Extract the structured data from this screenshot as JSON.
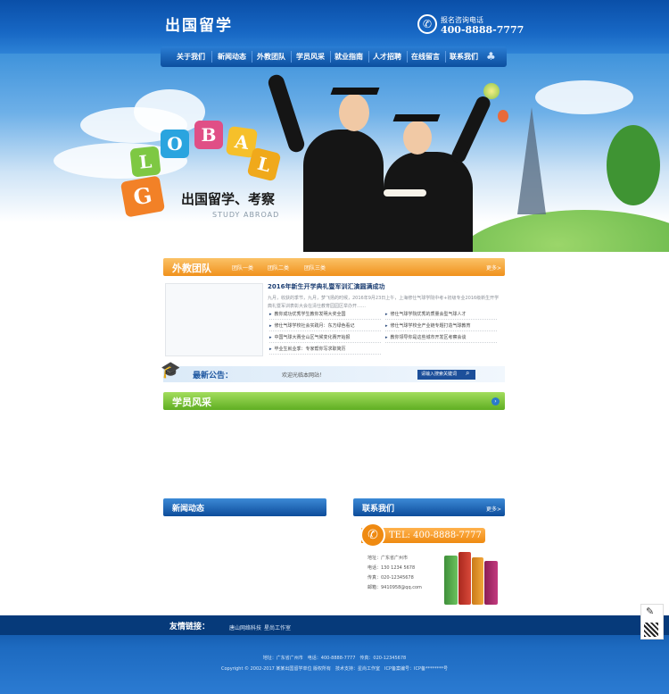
{
  "header": {
    "logo": "出国留学",
    "hotline_label": "报名咨询电话",
    "hotline_number": "400-8888-7777"
  },
  "nav": {
    "items": [
      "关于我们",
      "新闻动态",
      "外教团队",
      "学员风采",
      "就业指南",
      "人才招聘",
      "在线留言",
      "联系我们"
    ]
  },
  "banner": {
    "letters": [
      "G",
      "L",
      "O",
      "B",
      "A",
      "L"
    ],
    "title": "出国留学、考察",
    "subtitle": "STUDY ABROAD"
  },
  "teacher": {
    "title": "外教团队",
    "tabs": [
      "团队一类",
      "团队二类",
      "团队三类"
    ],
    "more": "更多>",
    "news_head": "2016年新生开学典礼暨军训汇演圆满成功",
    "news_summary": "九月，收获的季节，九月，梦飞扬的时候，2016年9月23日上午，上海修仕气球学院中考+初级专业2016级新生开学典礼暨军训表彰大会在清仕教育园园区举办开……",
    "news_left": [
      "教你成功优秀学生教你发明大奖全国",
      "修仕气球学校社会实践月：东方绿色看记",
      "中国气球大赛全山区气候变化赛开始报",
      "毕业生就业季：专家帮你写求职简历"
    ],
    "news_right": [
      "修仕气球学院优秀的质量会型气球人才",
      "修仕气球学校全产业链专题打造气球教育",
      "教你领导你是这些城市开发区考察会谈"
    ]
  },
  "notice": {
    "label": "最新公告：",
    "text": "欢迎光临本网站！",
    "search_placeholder": "请输入搜索关键词"
  },
  "students": {
    "title": "学员风采"
  },
  "news": {
    "title": "新闻动态",
    "more": "更多>"
  },
  "contact": {
    "title": "联系我们",
    "more": "更多>",
    "phone": "TEL: 400-8888-7777",
    "address": "地址：广东省广州市",
    "mobile": "电话：130 1234 5678",
    "fax": "传真：020-12345678",
    "email": "邮箱：9410958@qq.com"
  },
  "footer": {
    "links_label": "友情链接：",
    "links": [
      "唐山网络科技",
      "星尚工作室"
    ],
    "address_line": "地址：广东省广州市　电话：400-8888-7777　传真：020-12345678",
    "copyright_line": "Copyright © 2002-2017 某某出国留学单位 版权所有　技术支持：星尚工作室　ICP备案编号：ICP备********号"
  },
  "colors": {
    "primary_blue": "#1767c4",
    "orange": "#f0911c",
    "green": "#5fae22",
    "letter_blocks": [
      "#7ec843",
      "#2aa4df",
      "#f0a91b",
      "#e04f86",
      "#f6c02a",
      "#f28127"
    ]
  },
  "icons": [
    "phone-icon",
    "search-icon",
    "edit-icon",
    "qr-code-icon",
    "graduation-cap-icon",
    "next-arrow-icon"
  ]
}
